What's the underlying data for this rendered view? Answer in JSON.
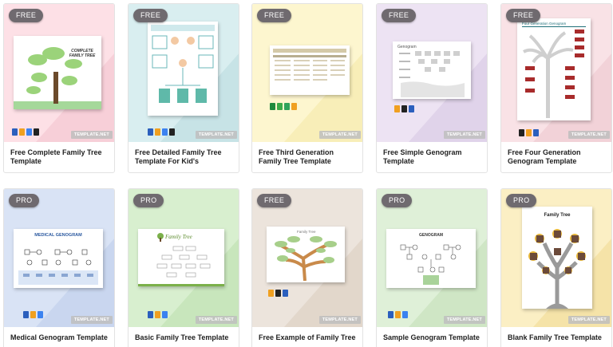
{
  "cards": [
    {
      "badge": "FREE",
      "title": "Free Complete Family Tree Template",
      "watermark": "TEMPLATE.NET",
      "bg": "#fde0e6",
      "icons": [
        "word",
        "pages",
        "gdoc",
        "pdf"
      ],
      "preview_text": "COMPLETE FAMILY TREE"
    },
    {
      "badge": "FREE",
      "title": "Free Detailed Family Tree Template For Kid's",
      "watermark": "TEMPLATE.NET",
      "bg": "#d9eef0",
      "icons": [
        "word",
        "pages",
        "gdoc",
        "pdf"
      ]
    },
    {
      "badge": "FREE",
      "title": "Free Third Generation Family Tree Template",
      "watermark": "TEMPLATE.NET",
      "bg": "#fdf6cf",
      "icons": [
        "excel",
        "numbers",
        "gsheet",
        "pages"
      ]
    },
    {
      "badge": "FREE",
      "title": "Free Simple Genogram Template",
      "watermark": "TEMPLATE.NET",
      "bg": "#ede3f3",
      "icons": [
        "pages",
        "pdf",
        "word"
      ],
      "preview_text": "Genogram"
    },
    {
      "badge": "FREE",
      "title": "Free Four Generation Genogram Template",
      "watermark": "TEMPLATE.NET",
      "bg": "#f9e2e6",
      "icons": [
        "pdf",
        "pages",
        "word"
      ],
      "preview_text": "Four Generation Genogram"
    },
    {
      "badge": "PRO",
      "title": "Medical Genogram Template",
      "watermark": "TEMPLATE.NET",
      "bg": "#d9e3f5",
      "icons": [
        "word",
        "pages",
        "gdoc"
      ],
      "preview_text": "MEDICAL GENOGRAM"
    },
    {
      "badge": "PRO",
      "title": "Basic Family Tree Template",
      "watermark": "TEMPLATE.NET",
      "bg": "#d8efcf",
      "icons": [
        "word",
        "pages",
        "gdoc"
      ],
      "preview_text": "Family Tree"
    },
    {
      "badge": "FREE",
      "title": "Free Example of Family Tree",
      "watermark": "TEMPLATE.NET",
      "bg": "#ece4dc",
      "icons": [
        "pages",
        "pdf",
        "word"
      ],
      "preview_text": "Family Tree"
    },
    {
      "badge": "PRO",
      "title": "Sample Genogram Template",
      "watermark": "TEMPLATE.NET",
      "bg": "#dff0d8",
      "icons": [
        "word",
        "pages",
        "gdoc"
      ],
      "preview_text": "GENOGRAM"
    },
    {
      "badge": "PRO",
      "title": "Blank Family Tree Template",
      "watermark": "TEMPLATE.NET",
      "bg": "#fbefc4",
      "icons": [
        "word",
        "pages",
        "gdoc"
      ],
      "preview_text": "Family Tree"
    }
  ]
}
